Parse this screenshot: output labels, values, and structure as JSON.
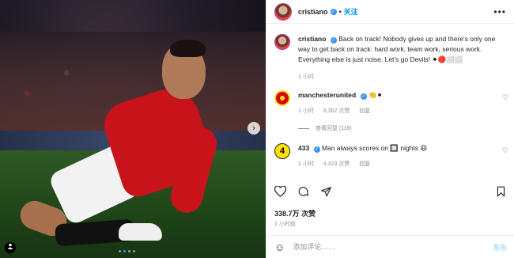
{
  "post": {
    "username": "cristiano",
    "separator": "•",
    "follow_label": "关注",
    "more_label": "•••",
    "caption": "Back on track! Nobody gives up and there's only one way to get back on track: hard work, team work, serious work. Everything else is just noise. Let's go Devils! ⚫🔴⬜⬜",
    "caption_time": "1 小时"
  },
  "comments": [
    {
      "username": "manchesterunited",
      "text": "👏⚫",
      "time": "1 小时",
      "likes": "6,362 次赞",
      "reply": "回复",
      "view_replies": "查看回复 (118)"
    },
    {
      "username": "433",
      "text": "Man always scores on 🔲 nights 😆",
      "time": "1 小时",
      "likes": "4,323 次赞",
      "reply": "回复"
    }
  ],
  "footer": {
    "likes": "338.7万 次赞",
    "time": "1 小时前",
    "comment_placeholder": "添加评论……",
    "post_label": "发布"
  },
  "icons": {
    "like": "heart-icon",
    "comment": "comment-icon",
    "share": "paper-plane-icon",
    "save": "bookmark-icon",
    "emoji": "smiley-icon",
    "next": "chevron-right-icon",
    "tag": "user-tag-icon"
  },
  "colors": {
    "accent": "#0095f6",
    "verified": "#3897f0",
    "muted": "#8e8e8e",
    "post_disabled": "#b2dffc"
  },
  "carousel": {
    "slides": 4,
    "current": 2
  }
}
